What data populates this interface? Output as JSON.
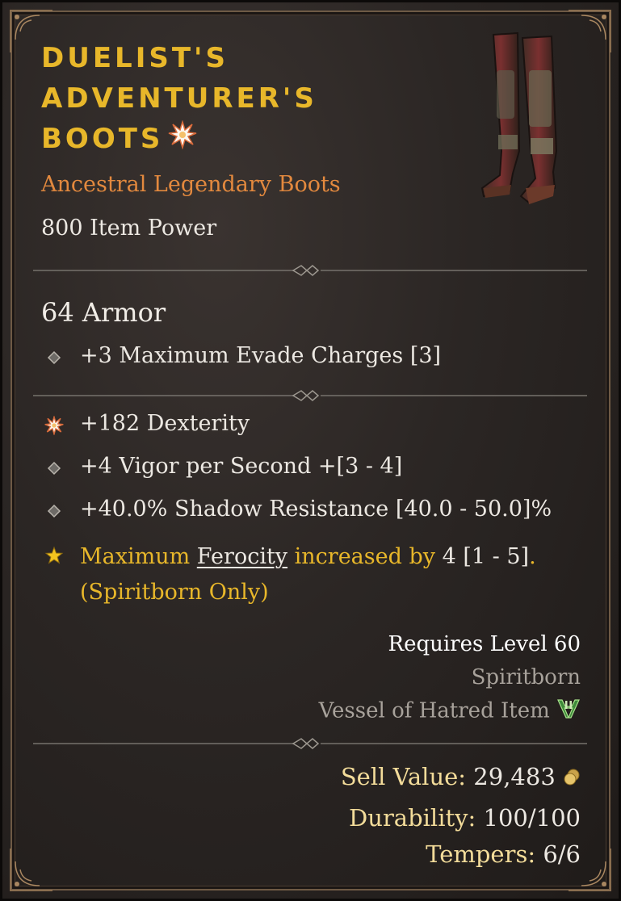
{
  "item": {
    "name_lines": [
      "DUELIST'S",
      "ADVENTURER'S",
      "BOOTS"
    ],
    "type": "Ancestral Legendary Boots",
    "item_power": "800 Item Power",
    "armor": "64 Armor",
    "icons": {
      "title_mark": "greater-affix-burst-icon",
      "image": "boots-item-image"
    }
  },
  "implicit_affixes": [
    {
      "icon": "diamond-bullet-icon",
      "text": "+3 Maximum Evade Charges [3]"
    }
  ],
  "affixes": [
    {
      "icon": "greater-affix-burst-icon",
      "text": "+182 Dexterity"
    },
    {
      "icon": "diamond-bullet-icon",
      "text": "+4 Vigor per Second +[3 - 4]"
    },
    {
      "icon": "diamond-bullet-icon",
      "text": "+40.0% Shadow Resistance [40.0 - 50.0]%"
    }
  ],
  "legendary_aspect": {
    "icon": "legendary-star-icon",
    "part1": "Maximum ",
    "keyword": "Ferocity",
    "part2": " increased by ",
    "value": "4",
    "range": " [1 - 5]",
    "end": ".",
    "line2": "(Spiritborn Only)"
  },
  "requirements": {
    "level": "Requires Level 60",
    "class": "Spiritborn",
    "expansion": "Vessel of Hatred Item",
    "expansion_icon": "vessel-of-hatred-icon"
  },
  "footer": {
    "sell_label": "Sell Value:",
    "sell_value": "29,483",
    "gold_icon": "gold-coins-icon",
    "durability_label": "Durability:",
    "durability_value": "100/100",
    "tempers_label": "Tempers:",
    "tempers_value": "6/6"
  },
  "colors": {
    "title": "#e8b72a",
    "type": "#e3893e",
    "aspect": "#e8b72a",
    "muted": "#a8a29b",
    "footer_label": "#f3dc9a"
  }
}
